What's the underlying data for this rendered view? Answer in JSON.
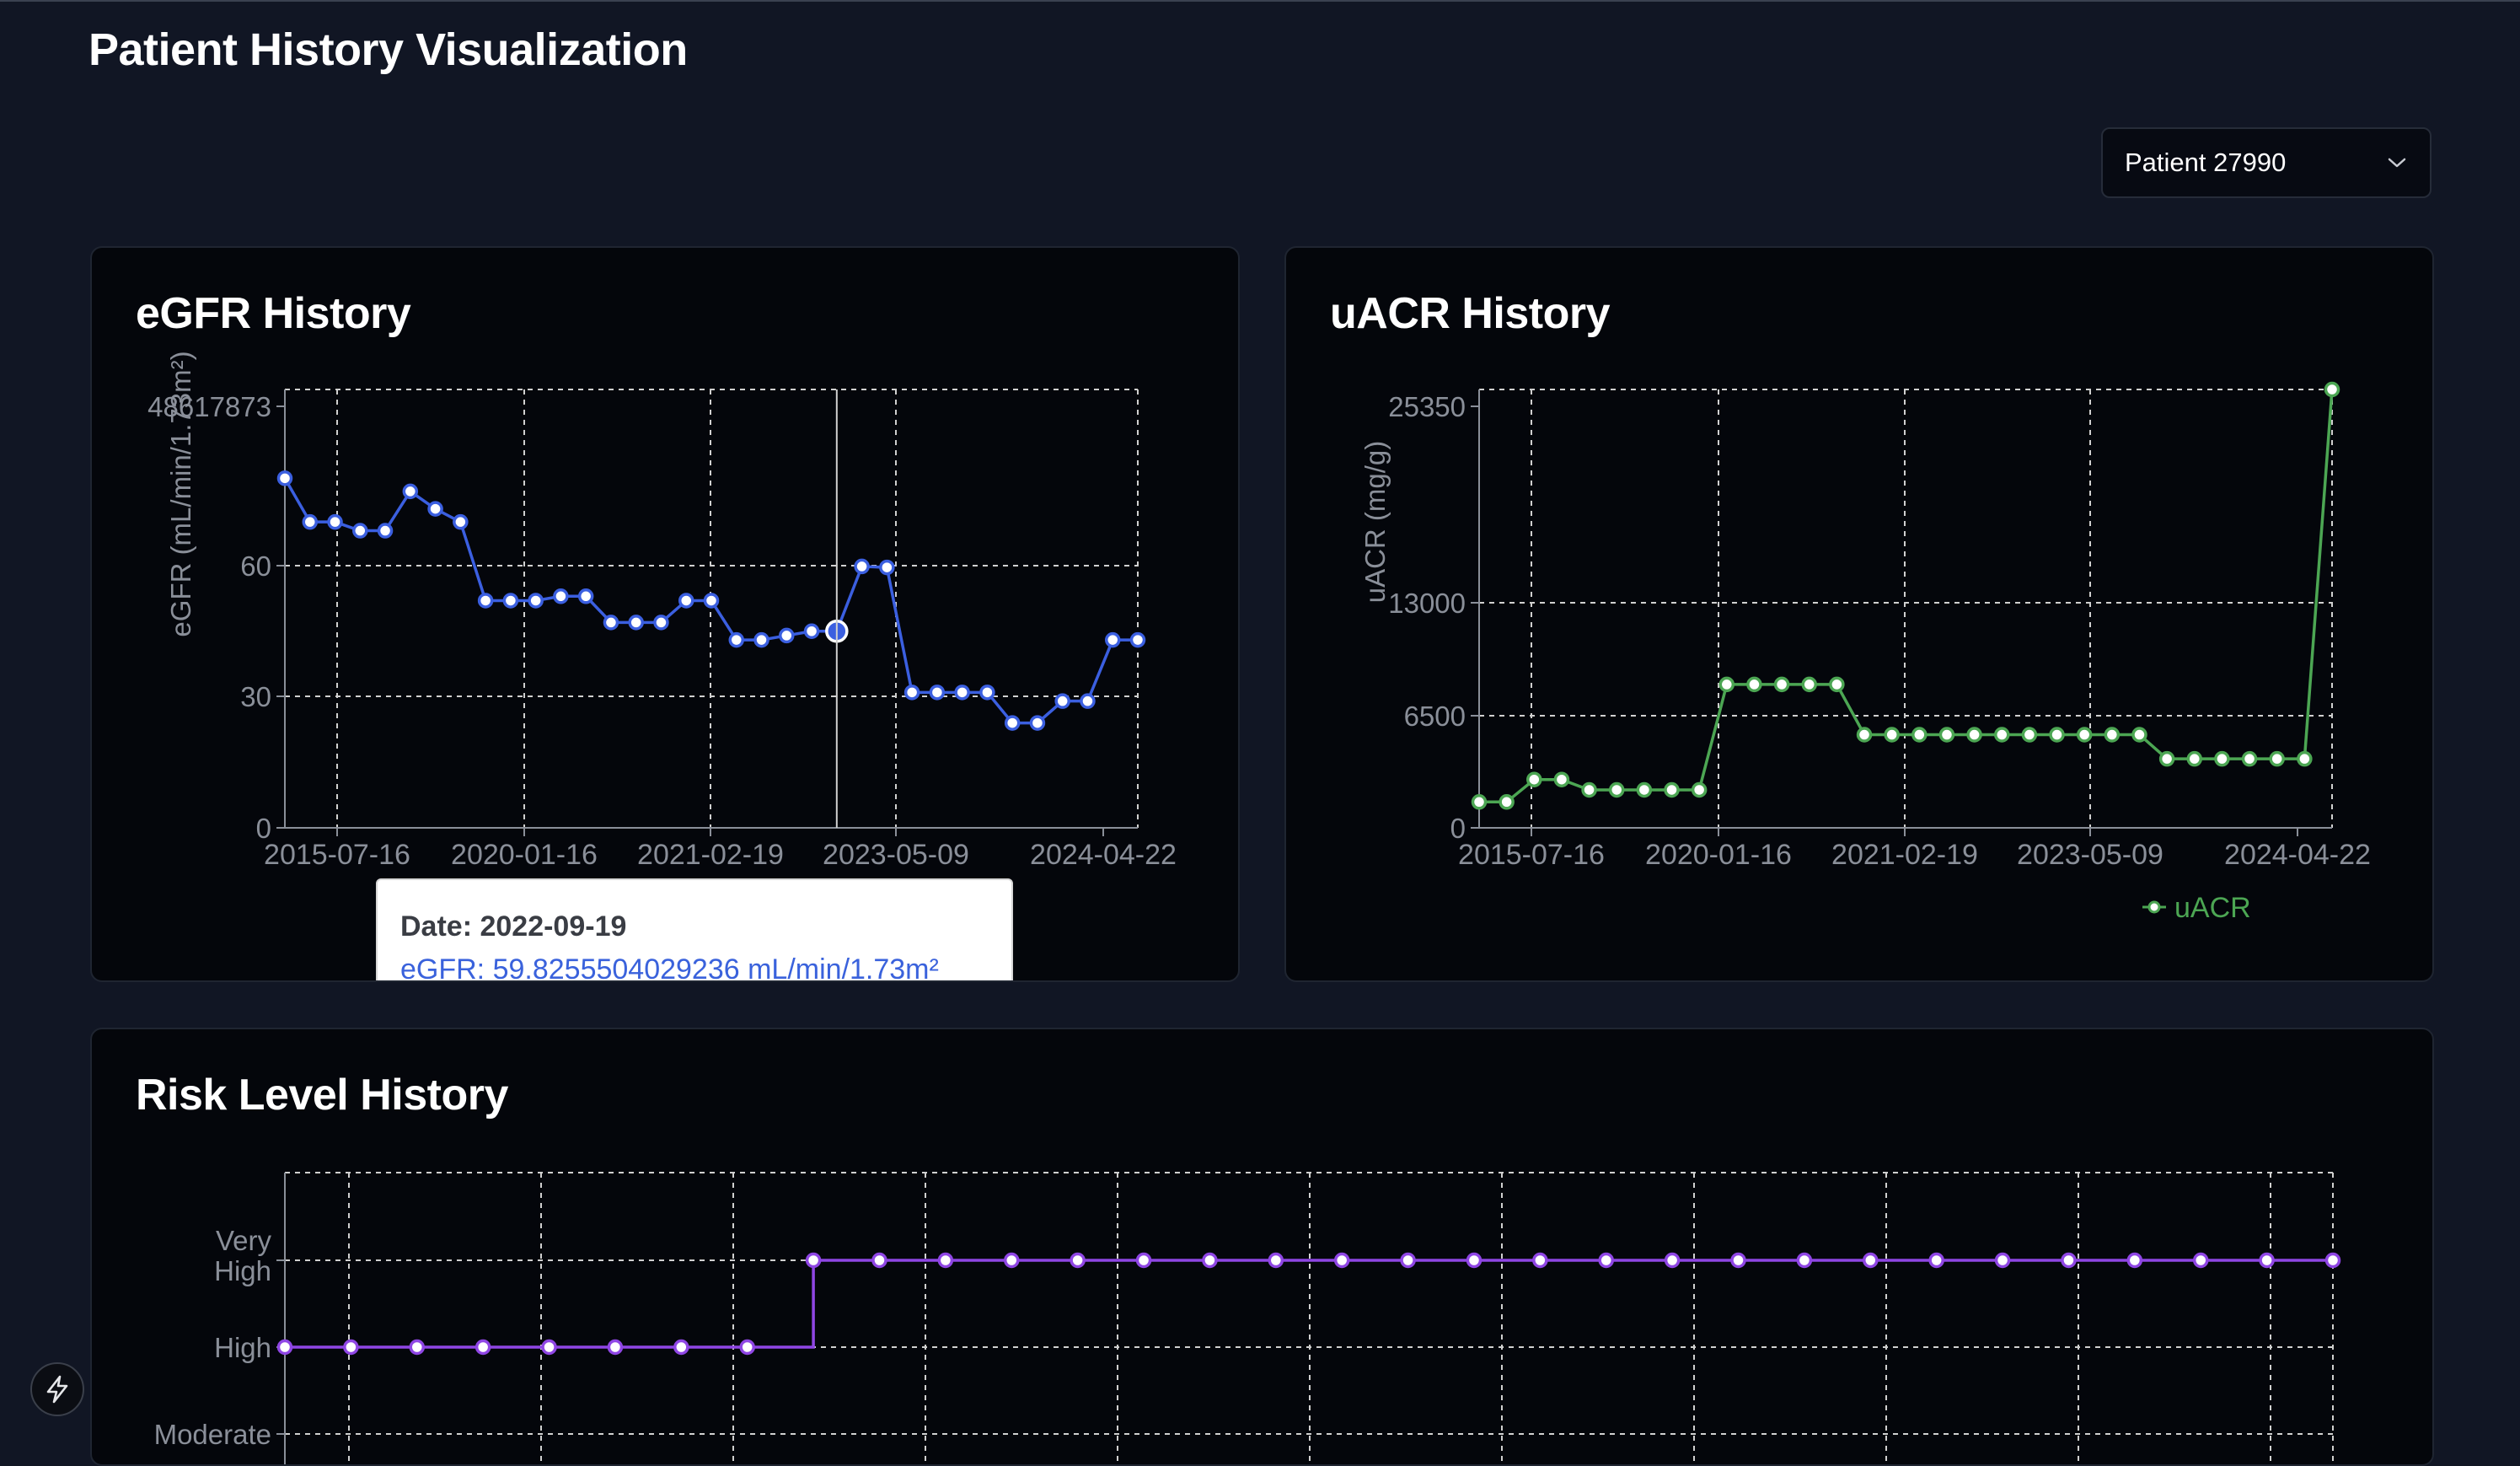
{
  "page": {
    "title": "Patient History Visualization"
  },
  "patient_select": {
    "selected": "Patient 27990"
  },
  "theme": {
    "egfr": "#3b5fe0",
    "uacr": "#4ca653",
    "risk": "#8f46e4",
    "axis": "#8a8f99",
    "grid": "#d0d0d0"
  },
  "charts": {
    "egfr": {
      "title": "eGFR History"
    },
    "uacr": {
      "title": "uACR History"
    },
    "risk": {
      "title": "Risk Level History"
    }
  },
  "tooltip": {
    "date": "Date: 2022-09-19",
    "value": "eGFR: 59.8255504029236 mL/min/1.73m²"
  },
  "chart_data": [
    {
      "type": "line",
      "title": "eGFR History",
      "ylabel": "eGFR (mL/min/1.73m²)",
      "ytick_labels": [
        "0",
        "30",
        "60",
        "48617873"
      ],
      "xtick_labels": [
        "2015-07-16",
        "2020-01-16",
        "2021-02-19",
        "2023-05-09",
        "2024-04-22"
      ],
      "series": [
        {
          "name": "eGFR",
          "values": [
            80,
            70,
            70,
            68,
            68,
            77,
            73,
            70,
            52,
            52,
            52,
            53,
            53,
            47,
            47,
            47,
            52,
            52,
            43,
            43,
            44,
            45,
            45,
            59.8255504029236,
            59.6,
            31,
            31,
            31,
            31,
            24,
            24,
            29,
            29,
            43,
            43
          ]
        }
      ],
      "highlight": {
        "index": 22,
        "date": "2022-09-19",
        "value": 59.8255504029236
      },
      "grid": true,
      "legend": "bottom"
    },
    {
      "type": "line",
      "title": "uACR History",
      "ylabel": "uACR (mg/g)",
      "ytick_labels": [
        "0",
        "6500",
        "13000",
        "25350"
      ],
      "xtick_labels": [
        "2015-07-16",
        "2020-01-16",
        "2021-02-19",
        "2023-05-09",
        "2024-04-22"
      ],
      "series": [
        {
          "name": "uACR",
          "values": [
            1500,
            1500,
            2800,
            2800,
            2200,
            2200,
            2200,
            2200,
            2200,
            8300,
            8300,
            8300,
            8300,
            8300,
            5400,
            5400,
            5400,
            5400,
            5400,
            5400,
            5400,
            5400,
            5400,
            5400,
            5400,
            4000,
            4000,
            4000,
            4000,
            4000,
            4000,
            25350
          ]
        }
      ],
      "grid": true,
      "legend": "bottom"
    },
    {
      "type": "line",
      "title": "Risk Level History",
      "ytick_labels": [
        "Moderate",
        "High",
        "Very High"
      ],
      "series": [
        {
          "name": "Risk Level",
          "values": [
            "High",
            "High",
            "High",
            "High",
            "High",
            "High",
            "High",
            "High",
            "Very High",
            "Very High",
            "Very High",
            "Very High",
            "Very High",
            "Very High",
            "Very High",
            "Very High",
            "Very High",
            "Very High",
            "Very High",
            "Very High",
            "Very High",
            "Very High",
            "Very High",
            "Very High",
            "Very High",
            "Very High",
            "Very High",
            "Very High",
            "Very High",
            "Very High",
            "Very High",
            "Very High"
          ]
        }
      ],
      "grid": true
    }
  ]
}
